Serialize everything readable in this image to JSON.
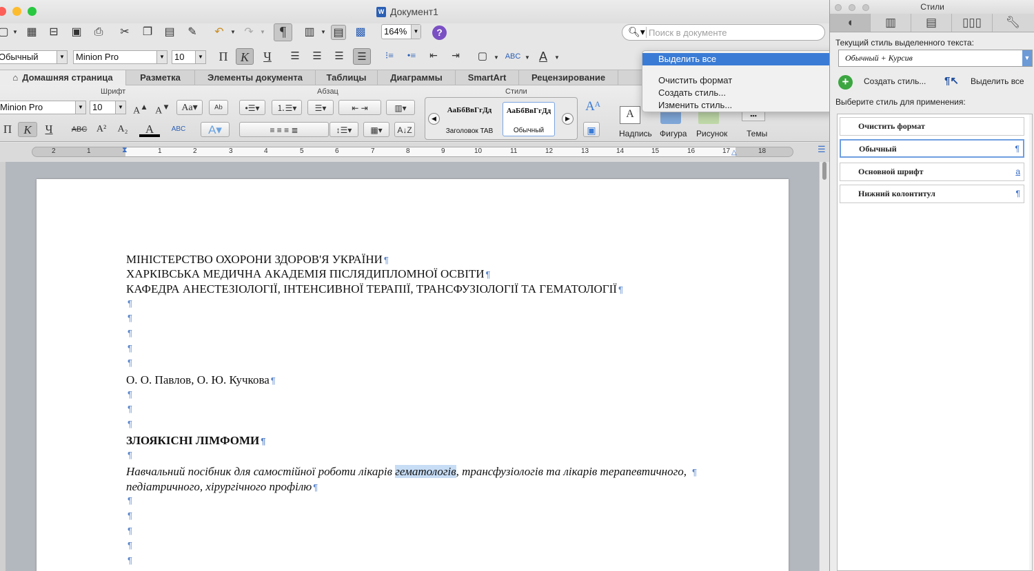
{
  "window": {
    "title": "Документ1",
    "doc_icon": "W"
  },
  "toolbar": {
    "zoom": "164%",
    "search_placeholder": "Поиск в документе",
    "help": "?"
  },
  "formatting": {
    "style": "Обычный",
    "font": "Minion Pro",
    "size": "10",
    "bold": "П",
    "italic": "К",
    "underline": "Ч"
  },
  "tabs": [
    {
      "label": "Домашняя страница"
    },
    {
      "label": "Разметка"
    },
    {
      "label": "Элементы документа"
    },
    {
      "label": "Таблицы"
    },
    {
      "label": "Диаграммы"
    },
    {
      "label": "SmartArt"
    },
    {
      "label": "Рецензирование"
    }
  ],
  "ribbon": {
    "groups": {
      "font": "Шрифт",
      "paragraph": "Абзац",
      "styles": "Стили"
    },
    "font_name": "Minion Pro",
    "font_size": "10",
    "style_tiles": [
      {
        "sample": "АаБбВвГгДд",
        "name": "Заголовок TAB"
      },
      {
        "sample": "АаБбВвГгДд",
        "name": "Обычный"
      }
    ],
    "insert": {
      "textbox": "Надпись",
      "shape": "Фигура",
      "picture": "Рисунок",
      "themes": "Темы"
    }
  },
  "ruler": {
    "numbers": [
      "2",
      "1",
      "1",
      "1",
      "2",
      "3",
      "4",
      "5",
      "6",
      "7",
      "8",
      "9",
      "10",
      "11",
      "12",
      "13",
      "14",
      "15",
      "16",
      "17",
      "18"
    ]
  },
  "document": {
    "pilcrow": "¶",
    "line1": "МІНІСТЕРСТВО ОХОРОНИ ЗДОРОВ'Я УКРАЇНИ",
    "line2": "ХАРКІВСЬКА МЕДИЧНА АКАДЕМІЯ ПІСЛЯДИПЛОМНОЇ ОСВІТИ",
    "line3": "КАФЕДРА АНЕСТЕЗІОЛОГІЇ, ІНТЕНСИВНОЇ ТЕРАПІЇ, ТРАНСФУЗІОЛОГІЇ ТА ГЕМАТОЛОГІЇ",
    "authors": "О. О. Павлов, О. Ю. Кучкова",
    "heading": "ЗЛОЯКІСНІ ЛІМФОМИ",
    "subtitle_before": "Навчальний посібник для самостійної роботи лікарів ",
    "subtitle_selected": "гематологів",
    "subtitle_after": ", трансфузіологів та лікарів терапевтичного,",
    "subtitle_line2": "педіатричного, хірургічного профілю"
  },
  "context_menu": {
    "items": [
      "Выделить все",
      "Очистить формат",
      "Создать стиль...",
      "Изменить стиль..."
    ],
    "selected_index": 0
  },
  "styles_palette": {
    "title": "Стили",
    "current_label": "Текущий стиль выделенного текста:",
    "current_value": "Обычный + Курсив",
    "create_style": "Создать стиль...",
    "select_all": "Выделить все",
    "apply_label": "Выберите стиль для применения:",
    "list": [
      {
        "name": "Очистить формат",
        "mark": ""
      },
      {
        "name": "Обычный",
        "mark": "¶"
      },
      {
        "name": "Основной шрифт",
        "mark": "a"
      },
      {
        "name": "Нижний колонтитул",
        "mark": "¶"
      }
    ],
    "selected_index": 1
  },
  "colors": {
    "accent": "#3a7bd5",
    "pilcrow": "#5b86c9",
    "selection": "#c7ddf5",
    "add_green": "#3ca641"
  }
}
